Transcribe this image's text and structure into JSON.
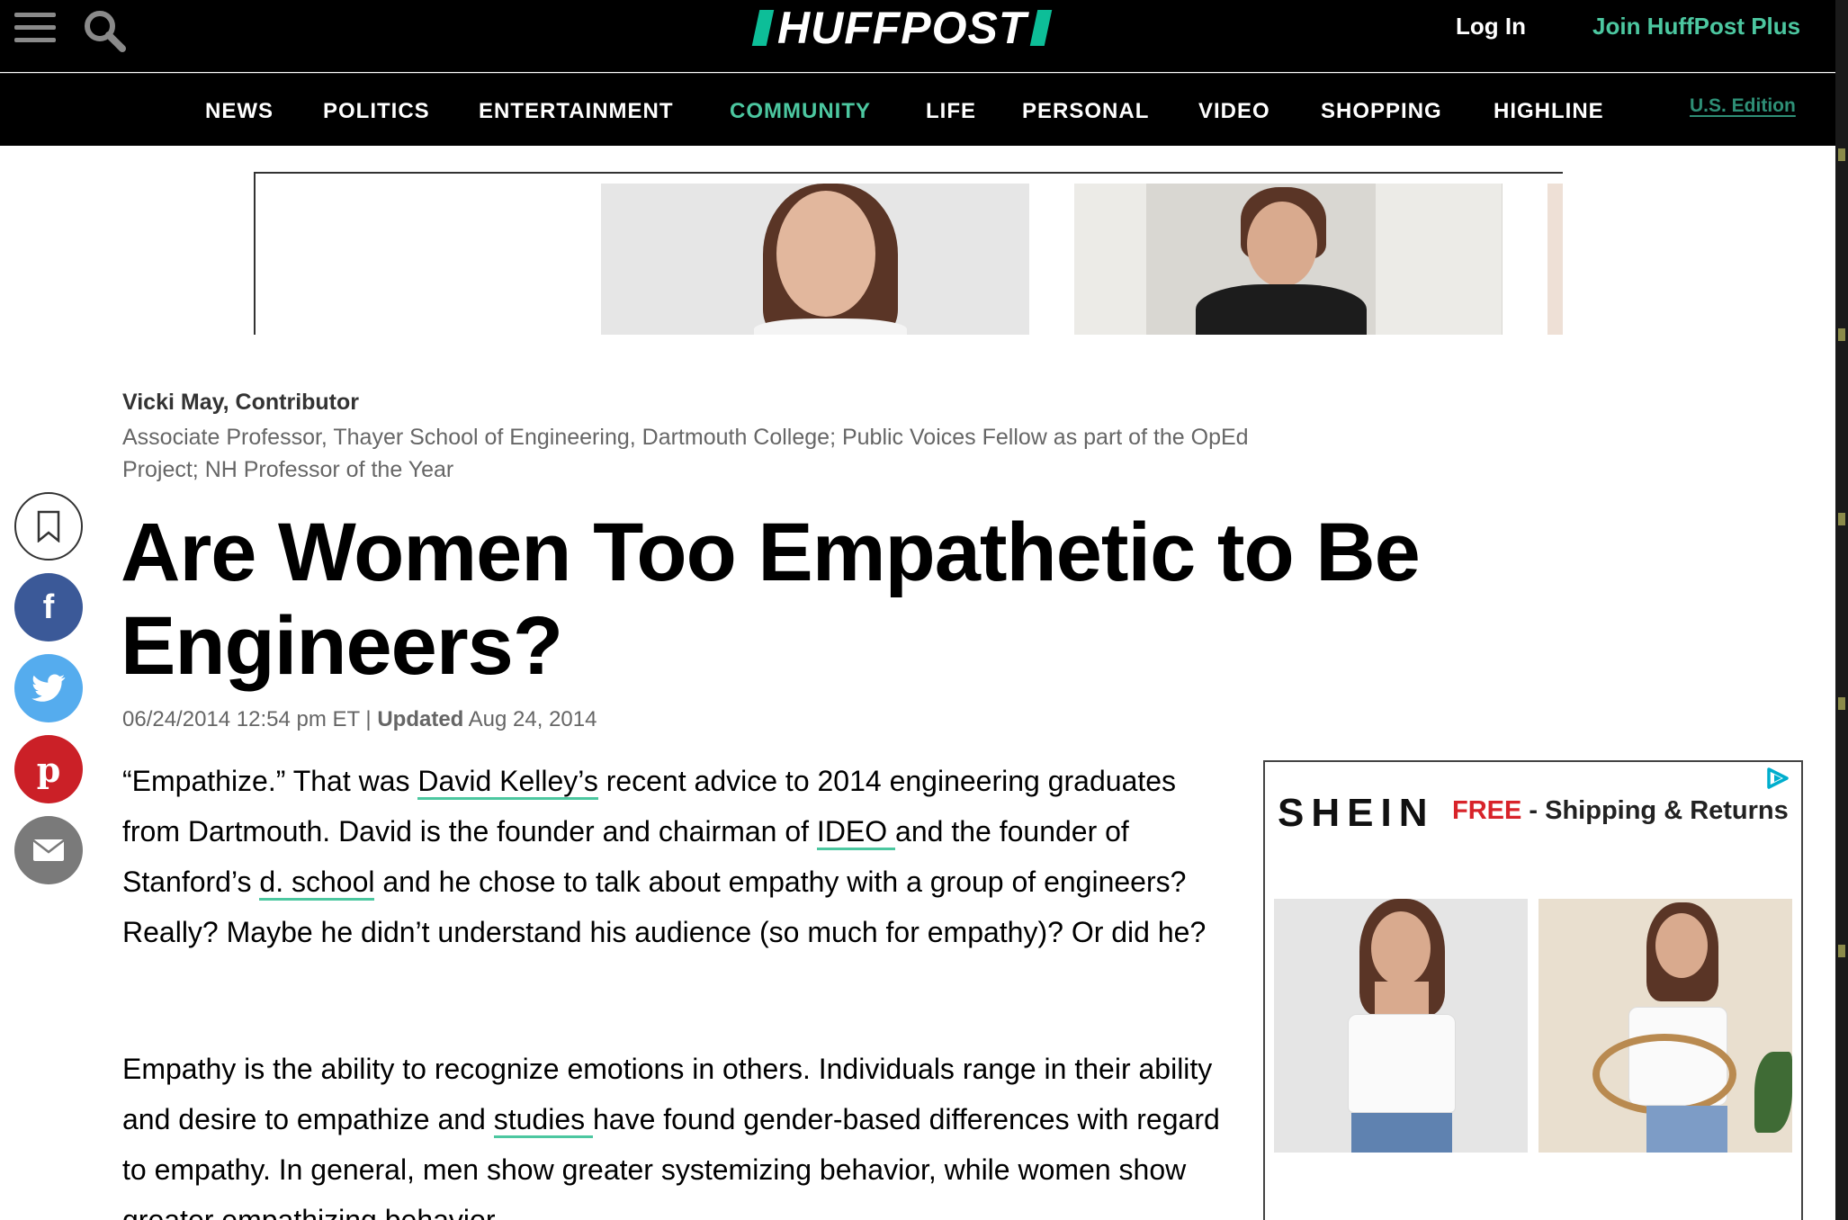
{
  "header": {
    "logo": "HUFFPOST",
    "login": "Log In",
    "join": "Join HuffPost Plus"
  },
  "nav": {
    "items": [
      "NEWS",
      "POLITICS",
      "ENTERTAINMENT",
      "COMMUNITY",
      "LIFE",
      "PERSONAL",
      "VIDEO",
      "SHOPPING",
      "HIGHLINE"
    ],
    "active": "COMMUNITY",
    "edition": "U.S. Edition"
  },
  "article": {
    "author": "Vicki May, Contributor",
    "bio": "Associate Professor, Thayer School of Engineering, Dartmouth College; Public Voices Fellow as part of the OpEd Project; NH Professor of the Year",
    "headline": "Are Women Too Empathetic to Be Engineers?",
    "published": "06/24/2014 12:54 pm ET |",
    "updated_label": "Updated",
    "updated_date": "Aug 24, 2014",
    "p1": {
      "t1": "“Empathize.” That was ",
      "link1": "David Kelley’s",
      "t2": " recent advice to 2014 engineering graduates from Dartmouth. David is the founder and chairman of ",
      "link2": "IDEO ",
      "t3": "and the founder of Stanford’s ",
      "link3": "d. school",
      "t4": " and he chose to talk about empathy with a group of engineers? Really? Maybe he didn’t understand his audience (so much for empathy)? Or did he?"
    },
    "p2": {
      "t1": "Empathy is the ability to recognize emotions in others. Individuals range in their ability and desire to empathize and ",
      "link1": "studies ",
      "t2": "have found gender-based differences with regard to empathy. In general, men show greater systemizing behavior, while women show greater empathizing behavior."
    }
  },
  "side_ad": {
    "brand": "SHEIN",
    "free": "FREE",
    "offer": " - Shipping & Returns"
  },
  "colors": {
    "accent": "#4cc7a0",
    "facebook": "#3b5998",
    "twitter": "#55acee",
    "pinterest": "#cb2027",
    "mail": "#7a7a7a"
  },
  "icons": [
    "menu-icon",
    "search-icon",
    "bookmark-icon",
    "facebook-icon",
    "twitter-icon",
    "pinterest-icon",
    "mail-icon",
    "adchoices-icon"
  ]
}
